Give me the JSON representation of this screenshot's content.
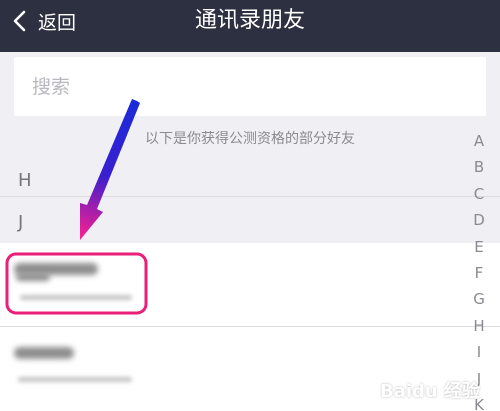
{
  "header": {
    "back_label": "返回",
    "title": "通讯录朋友",
    "background": "#2d3040"
  },
  "search": {
    "placeholder": "搜索"
  },
  "notice": "以下是你获得公测资格的部分好友",
  "sections": [
    "H",
    "J"
  ],
  "index_letters": [
    "A",
    "B",
    "C",
    "D",
    "E",
    "F",
    "G",
    "H",
    "I",
    "J",
    "K"
  ],
  "annotation": {
    "arrow_gradient": [
      "#1a2bd8",
      "#ff1f8e"
    ],
    "highlight_color": "#ea1f78"
  },
  "watermark": "Baidu 经验"
}
